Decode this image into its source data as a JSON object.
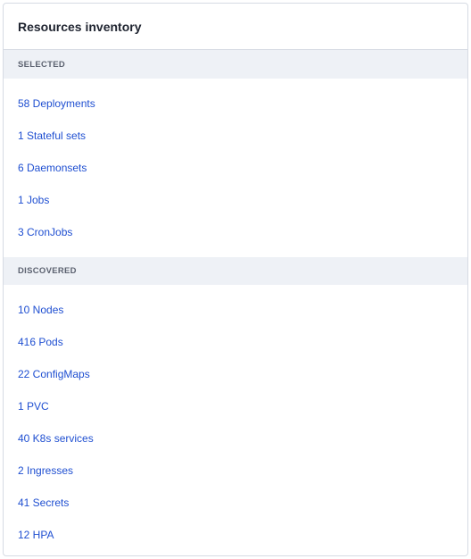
{
  "card": {
    "title": "Resources inventory"
  },
  "sections": {
    "selected": {
      "label": "SELECTED",
      "items": [
        "58 Deployments",
        "1 Stateful sets",
        "6 Daemonsets",
        "1 Jobs",
        "3 CronJobs"
      ]
    },
    "discovered": {
      "label": "DISCOVERED",
      "items": [
        "10 Nodes",
        "416 Pods",
        "22 ConfigMaps",
        "1 PVC",
        "40 K8s services",
        "2 Ingresses",
        "41 Secrets",
        "12 HPA"
      ]
    }
  },
  "colors": {
    "link": "#1f4fd1",
    "section_bg": "#eef1f6",
    "border": "#d6dbe3"
  }
}
